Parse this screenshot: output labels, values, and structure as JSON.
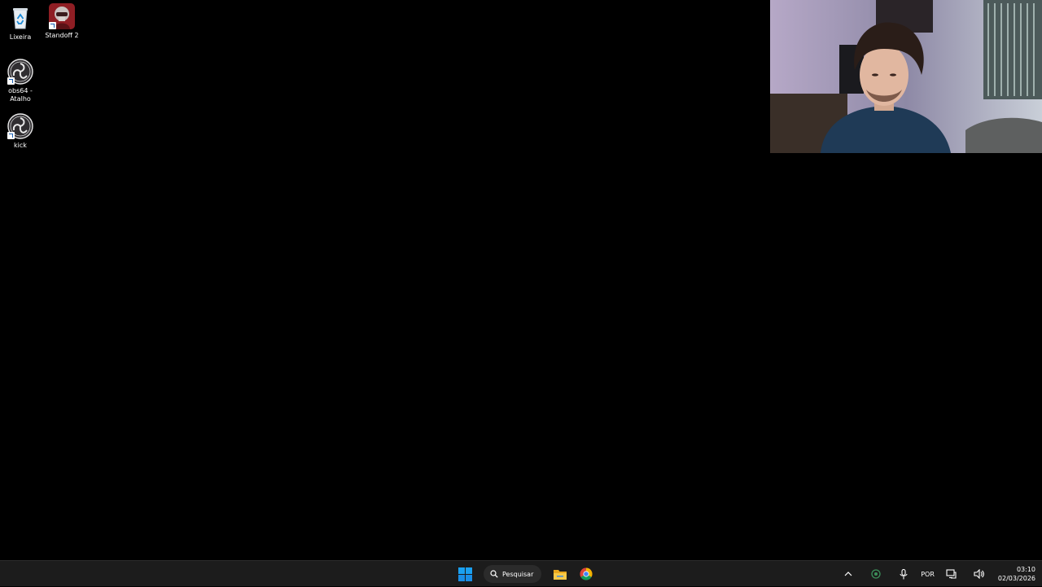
{
  "desktop": {
    "icons": [
      {
        "label": "Lixeira",
        "icon": "recycle-bin-icon"
      },
      {
        "label": "Standoff 2",
        "icon": "game-icon"
      },
      {
        "label": "obs64 -\nAtalho",
        "icon": "obs-icon"
      },
      {
        "label": "kick",
        "icon": "obs-icon"
      }
    ]
  },
  "webcam": {
    "description_icon": "webcam-overlay"
  },
  "taskbar": {
    "start_icon": "windows-start-icon",
    "search_label": "Pesquisar",
    "pinned": [
      {
        "name": "file-explorer-icon"
      },
      {
        "name": "chrome-icon"
      }
    ],
    "tray": {
      "language": "POR",
      "time": "03:10",
      "date": "02/03/2026"
    }
  },
  "colors": {
    "desktop_bg": "#000000",
    "taskbar_bg": "#1c1c1c",
    "start_blue": "#0078d4"
  }
}
